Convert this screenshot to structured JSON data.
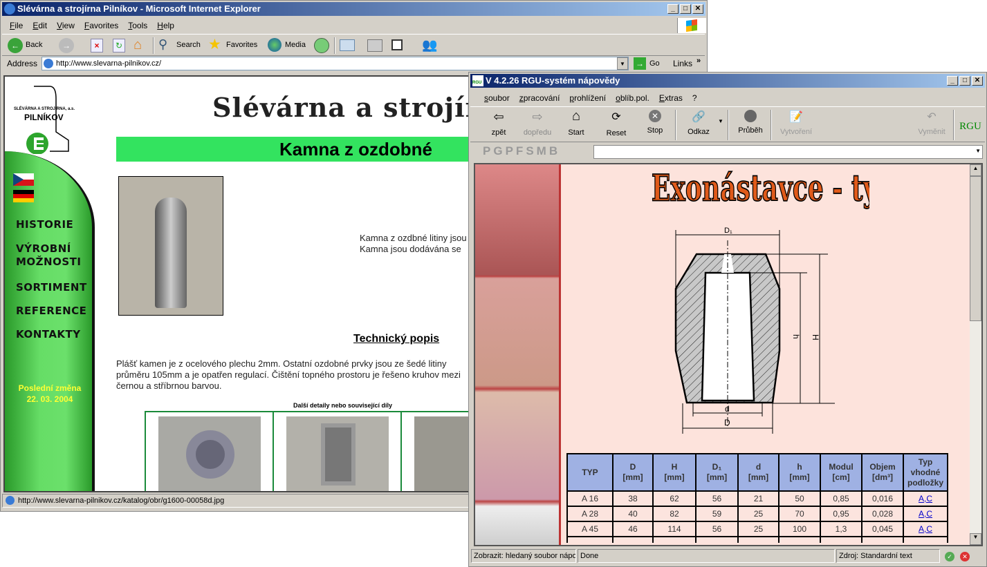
{
  "ie": {
    "title": "Slévárna a strojírna Pilníkov - Microsoft Internet Explorer",
    "menu": [
      "File",
      "Edit",
      "View",
      "Favorites",
      "Tools",
      "Help"
    ],
    "toolbar": {
      "back": "Back",
      "search": "Search",
      "favorites": "Favorites",
      "media": "Media"
    },
    "address_label": "Address",
    "address": "http://www.slevarna-pilnikov.cz/",
    "go": "Go",
    "links": "Links",
    "status": "http://www.slevarna-pilnikov.cz/katalog/obr/g1600-00058d.jpg",
    "page": {
      "logo_company": "SLÉVÁRNA A STROJÍRNA, a.s.",
      "logo_name": "PILNÍKOV",
      "heading": "Slévárna a strojírna, a",
      "banner": "Kamna z ozdobné",
      "nav": [
        "HISTORIE",
        "VÝROBNÍ MOŽNOSTI",
        "SORTIMENT",
        "REFERENCE",
        "KONTAKTY"
      ],
      "last_change_label": "Poslední změna",
      "last_change_date": "22. 03. 2004",
      "intro": [
        "Kamna z ozdbné litiny jsou",
        "Kamna jsou dodávána se"
      ],
      "tech_heading": "Technický popis",
      "tech_text": "Plášť kamen je z ocelového plechu 2mm. Ostatní ozdobné prvky jsou ze šedé litiny průměru 105mm a je opatřen regulací. Čištění topného prostoru je řešeno kruhov mezi černou a stříbrnou barvou.",
      "details_caption": "Další detaily nebo související díly"
    }
  },
  "rgu": {
    "title": "V 4.2.26 RGU-systém nápovědy",
    "menu": [
      "soubor",
      "zpracování",
      "prohlížení",
      "oblíb.pol.",
      "Extras",
      "?"
    ],
    "toolbar": [
      "zpět",
      "dopředu",
      "Start",
      "Reset",
      "Stop",
      "Odkaz",
      "Průběh",
      "Vytvoření",
      "Vyměnit"
    ],
    "letters": [
      "P",
      "G",
      "P",
      "F",
      "S",
      "M",
      "B"
    ],
    "logo": "RGU",
    "page_title": "Exonástavce - typ A",
    "diagram_labels": {
      "D1": "D₁",
      "h": "h",
      "H": "H",
      "d": "d",
      "D": "D"
    },
    "table": {
      "headers": [
        [
          "TYP",
          ""
        ],
        [
          "D",
          "[mm]"
        ],
        [
          "H",
          "[mm]"
        ],
        [
          "D₁",
          "[mm]"
        ],
        [
          "d",
          "[mm]"
        ],
        [
          "h",
          "[mm]"
        ],
        [
          "Modul",
          "[cm]"
        ],
        [
          "Objem",
          "[dm³]"
        ],
        [
          "Typ vhodné",
          "podložky"
        ]
      ],
      "rows": [
        [
          "A 16",
          "38",
          "62",
          "56",
          "21",
          "50",
          "0,85",
          "0,016",
          "A,C"
        ],
        [
          "A 28",
          "40",
          "82",
          "59",
          "25",
          "70",
          "0,95",
          "0,028",
          "A,C"
        ],
        [
          "A 45",
          "46",
          "114",
          "56",
          "25",
          "100",
          "1,3",
          "0,045",
          "A,C"
        ]
      ]
    },
    "status": [
      "Zobrazit: hledaný soubor nápo",
      "Done",
      "Zdroj: Standardní text"
    ]
  }
}
